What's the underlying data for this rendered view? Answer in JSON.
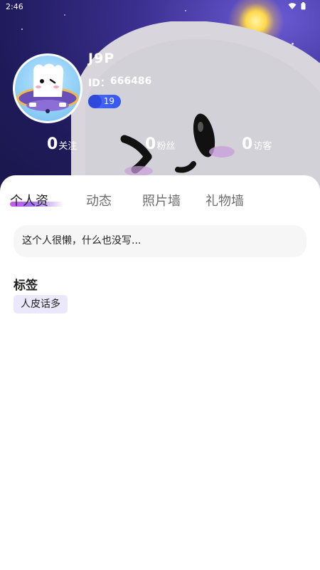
{
  "status_bar": {
    "time": "2:46"
  },
  "profile": {
    "username": "J9P",
    "id_label": "ID：",
    "id_value": "666486",
    "level": "19"
  },
  "stats": [
    {
      "num": "0",
      "label": "关注"
    },
    {
      "num": "0",
      "label": "粉丝"
    },
    {
      "num": "0",
      "label": "访客"
    }
  ],
  "tabs": [
    {
      "label": "个人资"
    },
    {
      "label": "动态"
    },
    {
      "label": "照片墙"
    },
    {
      "label": "礼物墙"
    }
  ],
  "active_tab": 0,
  "bio": "这个人很懒，什么也没写...",
  "tags": {
    "title": "标签",
    "items": [
      "人皮话多"
    ]
  },
  "colors": {
    "accent_gradient_start": "#c85ce8",
    "level_badge": "#4a6bff",
    "tag_bg": "#ece8fb"
  }
}
